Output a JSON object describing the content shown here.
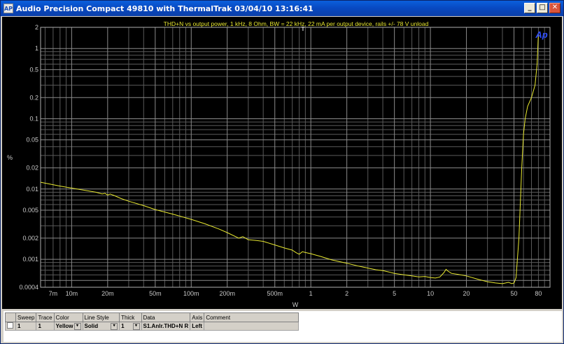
{
  "window": {
    "title": "Audio Precision  Compact 49810 with ThermalTrak  03/04/10 13:16:41",
    "app_icon": "AP",
    "minimize": "_",
    "maximize": "□",
    "close": "✕"
  },
  "chart_data": {
    "type": "line",
    "title": "THD+N vs output power, 1 kHz, 8 Ohm, BW = 22 kHz, 22 mA per output device, rails +/- 78 V unload",
    "xlabel": "W",
    "ylabel": "%",
    "xscale": "log",
    "yscale": "log",
    "xlim": [
      0.0055,
      100
    ],
    "ylim": [
      0.0004,
      2
    ],
    "grid": true,
    "logo": "Ap",
    "cursor_marker": "T",
    "x_ticks": [
      {
        "v": 0.007,
        "label": "7m"
      },
      {
        "v": 0.01,
        "label": "10m"
      },
      {
        "v": 0.02,
        "label": "20m"
      },
      {
        "v": 0.05,
        "label": "50m"
      },
      {
        "v": 0.1,
        "label": "100m"
      },
      {
        "v": 0.2,
        "label": "200m"
      },
      {
        "v": 0.5,
        "label": "500m"
      },
      {
        "v": 1,
        "label": "1"
      },
      {
        "v": 2,
        "label": "2"
      },
      {
        "v": 5,
        "label": "5"
      },
      {
        "v": 10,
        "label": "10"
      },
      {
        "v": 20,
        "label": "20"
      },
      {
        "v": 50,
        "label": "50"
      },
      {
        "v": 80,
        "label": "80"
      }
    ],
    "y_ticks": [
      {
        "v": 2,
        "label": "2"
      },
      {
        "v": 1,
        "label": "1"
      },
      {
        "v": 0.5,
        "label": "0.5"
      },
      {
        "v": 0.2,
        "label": "0.2"
      },
      {
        "v": 0.1,
        "label": "0.1"
      },
      {
        "v": 0.05,
        "label": "0.05"
      },
      {
        "v": 0.02,
        "label": "0.02"
      },
      {
        "v": 0.01,
        "label": "0.01"
      },
      {
        "v": 0.005,
        "label": "0.005"
      },
      {
        "v": 0.002,
        "label": "0.002"
      },
      {
        "v": 0.001,
        "label": "0.001"
      },
      {
        "v": 0.0004,
        "label": "0.0004"
      }
    ],
    "series": [
      {
        "color": "#e8e830",
        "x": [
          0.0055,
          0.008,
          0.012,
          0.016,
          0.018,
          0.019,
          0.02,
          0.021,
          0.023,
          0.026,
          0.03,
          0.04,
          0.05,
          0.07,
          0.1,
          0.13,
          0.17,
          0.2,
          0.25,
          0.27,
          0.3,
          0.35,
          0.4,
          0.5,
          0.6,
          0.7,
          0.75,
          0.8,
          0.85,
          0.9,
          1.0,
          1.2,
          1.5,
          2.0,
          2.5,
          3.0,
          3.5,
          4.0,
          4.5,
          5.0,
          6.0,
          7.0,
          8.0,
          9.0,
          10,
          11,
          12,
          13,
          13.5,
          14,
          15,
          17,
          20,
          25,
          30,
          35,
          40,
          45,
          48,
          50,
          52,
          55,
          58,
          60,
          62,
          65,
          70,
          75,
          78,
          80
        ],
        "y": [
          0.0125,
          0.011,
          0.0098,
          0.009,
          0.0085,
          0.0087,
          0.0082,
          0.0085,
          0.008,
          0.0073,
          0.0067,
          0.0058,
          0.0051,
          0.0044,
          0.0037,
          0.0032,
          0.0027,
          0.0024,
          0.002,
          0.0021,
          0.0019,
          0.00185,
          0.0018,
          0.0016,
          0.00145,
          0.00135,
          0.00125,
          0.00118,
          0.00128,
          0.00125,
          0.0012,
          0.0011,
          0.00098,
          0.00088,
          0.0008,
          0.00075,
          0.00071,
          0.00069,
          0.00066,
          0.00063,
          0.0006,
          0.00058,
          0.00056,
          0.00057,
          0.00055,
          0.00054,
          0.00056,
          0.00065,
          0.00072,
          0.00068,
          0.00063,
          0.00061,
          0.00058,
          0.00052,
          0.00048,
          0.00046,
          0.00045,
          0.00047,
          0.00045,
          0.00046,
          0.00055,
          0.002,
          0.02,
          0.06,
          0.1,
          0.15,
          0.2,
          0.3,
          0.6,
          1.6
        ]
      }
    ]
  },
  "legend": {
    "headers": [
      "Sweep",
      "Trace",
      "Color",
      "Line Style",
      "Thick",
      "Data",
      "Axis",
      "Comment"
    ],
    "rows": [
      {
        "sweep": "1",
        "trace": "1",
        "color": "Yellow",
        "line_style": "Solid",
        "thick": "1",
        "data": "S1.Anlr.THD+N R",
        "axis": "Left",
        "comment": ""
      }
    ]
  }
}
